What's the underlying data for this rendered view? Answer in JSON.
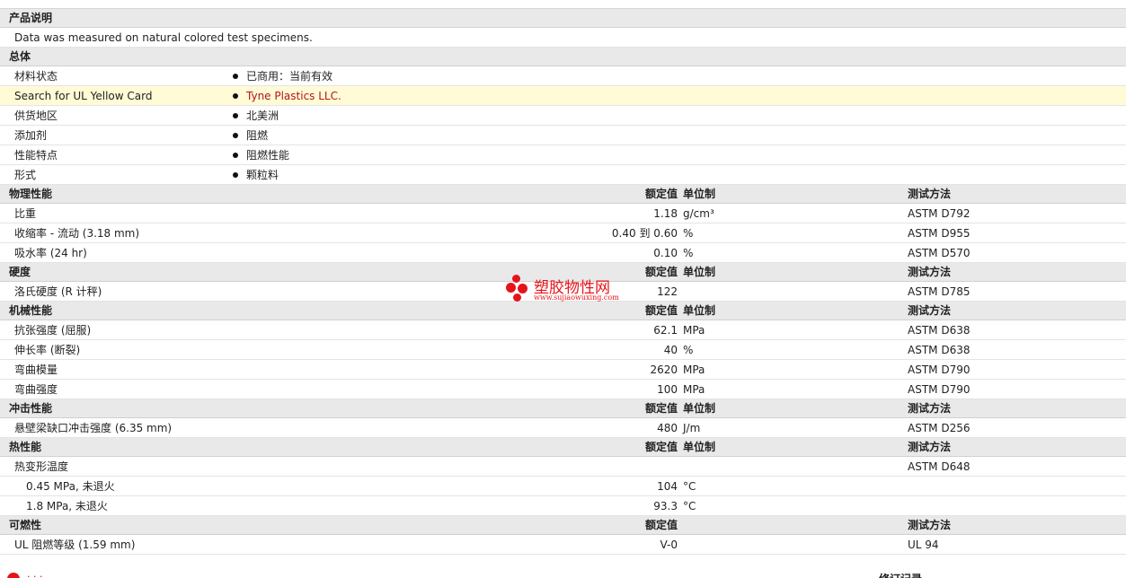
{
  "product_note": {
    "header": "产品说明",
    "text": "Data was measured on natural colored test specimens."
  },
  "general": {
    "header": "总体",
    "rows": [
      {
        "label": "材料状态",
        "value": "已商用：当前有效"
      },
      {
        "label": "Search for UL Yellow Card",
        "value": "Tyne Plastics LLC."
      },
      {
        "label": "供货地区",
        "value": "北美洲"
      },
      {
        "label": "添加剂",
        "value": "阻燃"
      },
      {
        "label": "性能特点",
        "value": "阻燃性能"
      },
      {
        "label": "形式",
        "value": "颗粒料"
      }
    ]
  },
  "col_headers": {
    "value": "额定值",
    "unit": "单位制",
    "method": "测试方法"
  },
  "physical": {
    "header": "物理性能",
    "rows": [
      {
        "label": "比重",
        "value": "1.18",
        "unit": "g/cm³",
        "method": "ASTM D792"
      },
      {
        "label": "收缩率  - 流动  (3.18 mm)",
        "value": "0.40 到  0.60",
        "unit": "%",
        "method": "ASTM D955"
      },
      {
        "label": "吸水率  (24 hr)",
        "value": "0.10",
        "unit": "%",
        "method": "ASTM D570"
      }
    ]
  },
  "hardness": {
    "header": "硬度",
    "rows": [
      {
        "label": "洛氏硬度  (R 计秤)",
        "value": "122",
        "unit": "",
        "method": "ASTM D785"
      }
    ]
  },
  "mechanical": {
    "header": "机械性能",
    "rows": [
      {
        "label": "抗张强度  (屈服)",
        "value": "62.1",
        "unit": "MPa",
        "method": "ASTM D638"
      },
      {
        "label": "伸长率  (断裂)",
        "value": "40",
        "unit": "%",
        "method": "ASTM D638"
      },
      {
        "label": "弯曲模量",
        "value": "2620",
        "unit": "MPa",
        "method": "ASTM D790"
      },
      {
        "label": "弯曲强度",
        "value": "100",
        "unit": "MPa",
        "method": "ASTM D790"
      }
    ]
  },
  "impact": {
    "header": "冲击性能",
    "rows": [
      {
        "label": "悬壁梁缺口冲击强度  (6.35 mm)",
        "value": "480",
        "unit": "J/m",
        "method": "ASTM D256"
      }
    ]
  },
  "thermal": {
    "header": "热性能",
    "rows": [
      {
        "label": "热变形温度",
        "value": "",
        "unit": "",
        "method": "ASTM D648"
      },
      {
        "label": "0.45 MPa, 未退火",
        "value": "104",
        "unit": "°C",
        "method": ""
      },
      {
        "label": "1.8 MPa, 未退火",
        "value": "93.3",
        "unit": "°C",
        "method": ""
      }
    ]
  },
  "flammability": {
    "header": "可燃性",
    "rows": [
      {
        "label": "UL 阻燃等级  (1.59 mm)",
        "value": "V-0",
        "unit": "",
        "method": "UL 94"
      }
    ]
  },
  "watermark": {
    "title": "塑胶物性网",
    "url": "www.sujiaowuxing.com",
    "color": "#e5141b"
  },
  "footer": {
    "left_text": "· · ·",
    "right_text": "修订记录"
  },
  "colors": {
    "link_red": "#b3151b",
    "highlight": "#fffbd6",
    "header_bg": "#e9e9e9"
  }
}
